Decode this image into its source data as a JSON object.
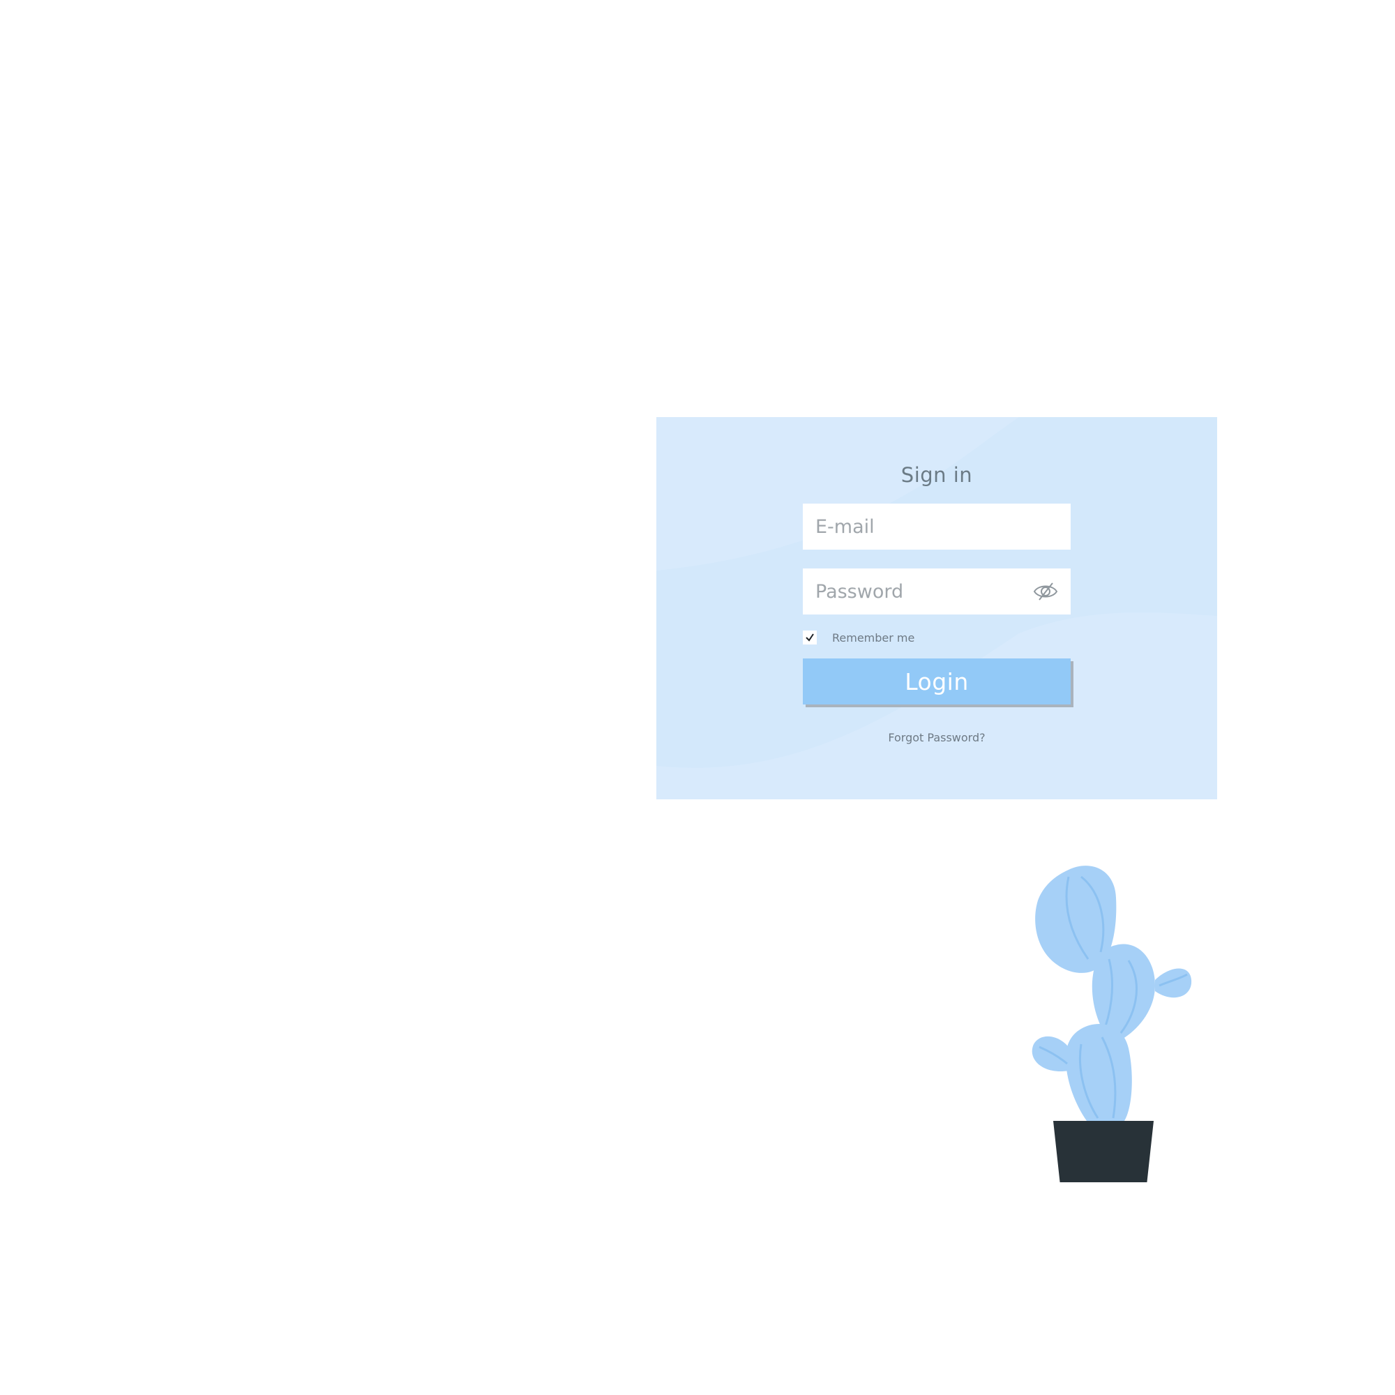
{
  "login": {
    "title": "Sign in",
    "email_placeholder": "E-mail",
    "password_placeholder": "Password",
    "remember_label": "Remember me",
    "remember_checked": true,
    "login_label": "Login",
    "forgot_label": "Forgot Password?"
  },
  "icons": {
    "password_toggle": "eye-slash-icon",
    "checkbox": "check-icon",
    "illustration": "cactus-illustration"
  },
  "colors": {
    "card_background": "#d3e8fb",
    "button": "#92c9f7",
    "button_shadow": "#a9b3bd",
    "cactus": "#a6d0f7",
    "pot": "#283238",
    "text_muted": "#6e7a85"
  }
}
